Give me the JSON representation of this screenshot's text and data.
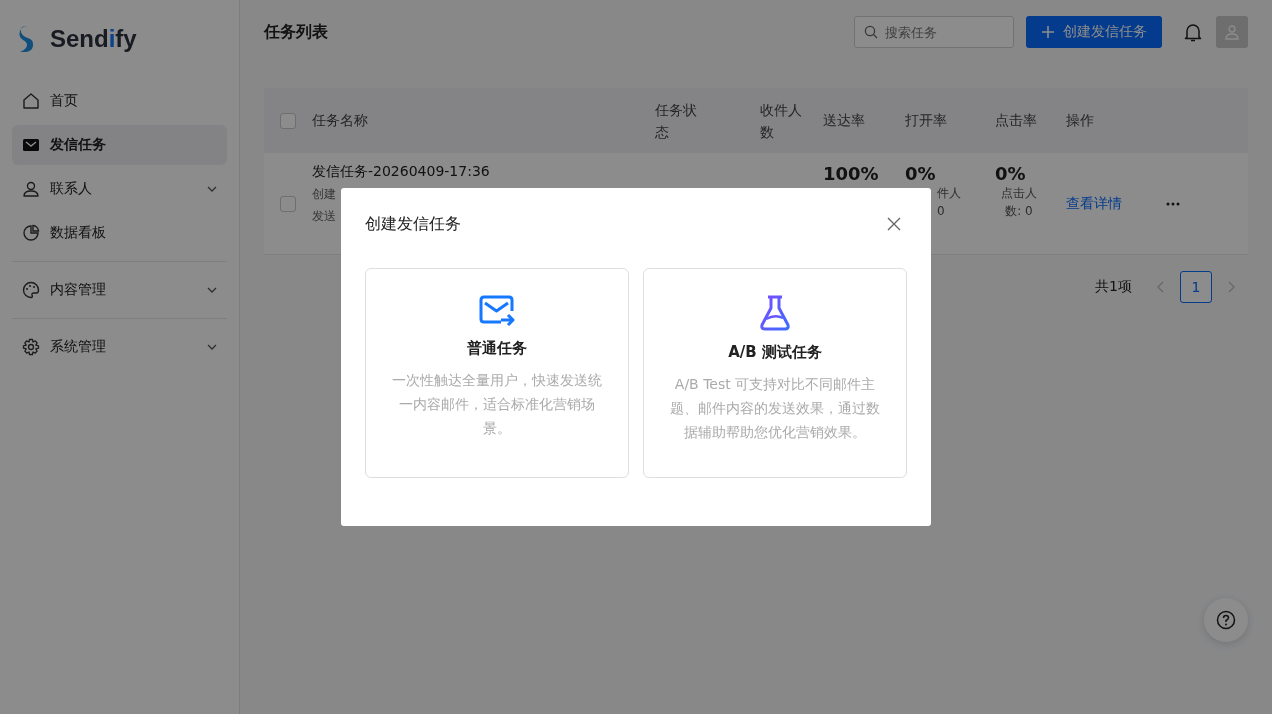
{
  "sidebar": {
    "logo": [
      {
        "text": "Send",
        "accent": false
      },
      {
        "text": "i",
        "accent": true
      },
      {
        "text": "fy",
        "accent": false
      }
    ],
    "sections": [
      {
        "items": [
          {
            "label": "首页",
            "selected": false,
            "expandable": false
          },
          {
            "label": "发信任务",
            "selected": true,
            "expandable": false
          },
          {
            "label": "联系人",
            "selected": false,
            "expandable": true
          },
          {
            "label": "数据看板",
            "selected": false,
            "expandable": false
          }
        ]
      },
      {
        "items": [
          {
            "label": "内容管理",
            "selected": false,
            "expandable": true
          }
        ]
      },
      {
        "items": [
          {
            "label": "系统管理",
            "selected": false,
            "expandable": true
          }
        ]
      }
    ]
  },
  "header": {
    "title": "任务列表",
    "search": {
      "placeholder": "搜索任务"
    },
    "create_button": {
      "label": "创建发信任务"
    }
  },
  "table": {
    "header_checkbox": {
      "checked": false
    },
    "columns": [
      "任务名称",
      "任务状态",
      "收件人数",
      "送达率",
      "打开率",
      "点击率",
      "操作"
    ],
    "rows": [
      {
        "checked": false,
        "name": "发信任务-20260409-17:36",
        "meta": [
          "创建",
          "发送"
        ],
        "delivery": "100%",
        "open": {
          "rate": "0%",
          "detail": [
            "件人",
            "0"
          ]
        },
        "click": {
          "rate": "0%",
          "detail": "点击人数: 0"
        },
        "action": "查看详情"
      }
    ]
  },
  "pagination": {
    "total": "共1项",
    "pages": [
      {
        "label": "1",
        "selected": true
      }
    ]
  },
  "modal": {
    "title": "创建发信任务",
    "options": [
      {
        "title": "普通任务",
        "description": "一次性触达全量用户，快速发送统一内容邮件，适合标准化营销场景。"
      },
      {
        "title": "A/B 测试任务",
        "description": "A/B Test 可支持对比不同邮件主题、邮件内容的发送效果，通过数据辅助帮助您优化营销效果。"
      }
    ]
  }
}
